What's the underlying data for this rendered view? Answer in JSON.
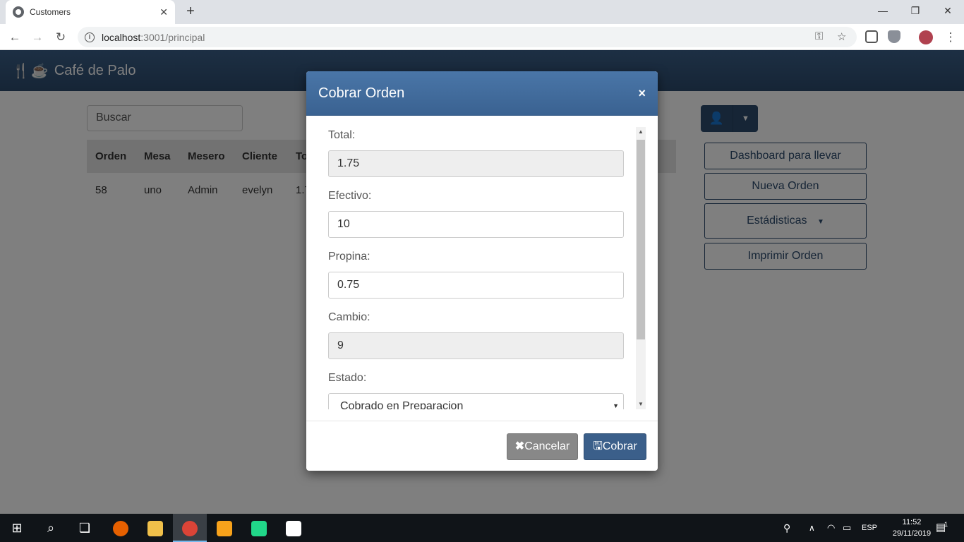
{
  "browser": {
    "tab_title": "Customers",
    "url_host": "localhost",
    "url_path": ":3001/principal"
  },
  "app": {
    "brand": "Café de Palo",
    "search_placeholder": "Buscar",
    "table": {
      "headers": [
        "Orden",
        "Mesa",
        "Mesero",
        "Cliente",
        "To"
      ],
      "rows": [
        [
          "58",
          "uno",
          "Admin",
          "evelyn",
          "1.7"
        ]
      ]
    },
    "side_buttons": {
      "dashboard": "Dashboard para llevar",
      "nueva_orden": "Nueva Orden",
      "estadisticas": "Estádisticas",
      "imprimir": "Imprimir Orden"
    }
  },
  "modal": {
    "title": "Cobrar Orden",
    "close": "×",
    "fields": {
      "total_label": "Total:",
      "total_value": "1.75",
      "efectivo_label": "Efectivo:",
      "efectivo_value": "10",
      "propina_label": "Propina:",
      "propina_value": "0.75",
      "cambio_label": "Cambio:",
      "cambio_value": "9",
      "estado_label": "Estado:",
      "estado_value": "Cobrado en Preparacion"
    },
    "buttons": {
      "cancel": "Cancelar",
      "submit": "Cobrar"
    }
  },
  "taskbar": {
    "language": "ESP",
    "time": "11:52",
    "date": "29/11/2019",
    "notifications": "1"
  }
}
